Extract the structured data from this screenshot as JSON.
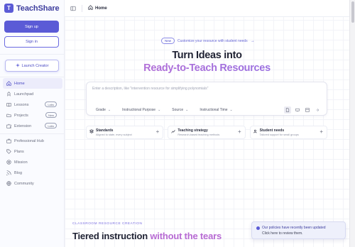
{
  "brand": {
    "logo_letter": "T",
    "name": "TeachShare"
  },
  "auth": {
    "signup_label": "Sign up",
    "signin_label": "Sign in"
  },
  "launch": {
    "label": "Launch Creator"
  },
  "nav": {
    "items": [
      {
        "label": "Home",
        "icon": "home-icon",
        "active": true
      },
      {
        "label": "Launchpad",
        "icon": "rocket-icon"
      },
      {
        "label": "Lessons",
        "icon": "book-icon",
        "badge": "Labs"
      },
      {
        "label": "Projects",
        "icon": "folder-icon",
        "badge": "New"
      },
      {
        "label": "Extension",
        "icon": "puzzle-icon",
        "badge": "Labs"
      }
    ],
    "secondary": [
      {
        "label": "Professional Hub",
        "icon": "briefcase-icon"
      },
      {
        "label": "Plans",
        "icon": "tag-icon"
      },
      {
        "label": "Mission",
        "icon": "target-icon"
      },
      {
        "label": "Blog",
        "icon": "feed-icon"
      },
      {
        "label": "Community",
        "icon": "globe-icon"
      }
    ]
  },
  "topbar": {
    "crumb": "Home"
  },
  "announcement": {
    "badge": "New",
    "text": "Customize your resource with student needs",
    "arrow": "→"
  },
  "hero": {
    "line1": "Turn Ideas into",
    "line2": "Ready-to-Teach Resources"
  },
  "prompt": {
    "placeholder": "Enter a description, like \"intervention resource for simplifying polynomials\"",
    "selects": [
      "Grade",
      "Instructional Purpose",
      "Source",
      "Instructional Time"
    ]
  },
  "cards": [
    {
      "title": "Standards",
      "subtitle": "Aligned to state, every subject"
    },
    {
      "title": "Teaching strategy",
      "subtitle": "Research-based teaching methods"
    },
    {
      "title": "Student needs",
      "subtitle": "Tailored support for small groups"
    }
  ],
  "section": {
    "label": "CLASSROOM RESOURCE CREATION",
    "title_plain": "Tiered instruction",
    "title_accent": "without the tears"
  },
  "toast": {
    "title": "Our policies have recently been updated",
    "body": "Click here to review them."
  },
  "colors": {
    "accent": "#5b5bd6",
    "gradient_start": "#c06fd2",
    "gradient_end": "#8b6fe6"
  }
}
